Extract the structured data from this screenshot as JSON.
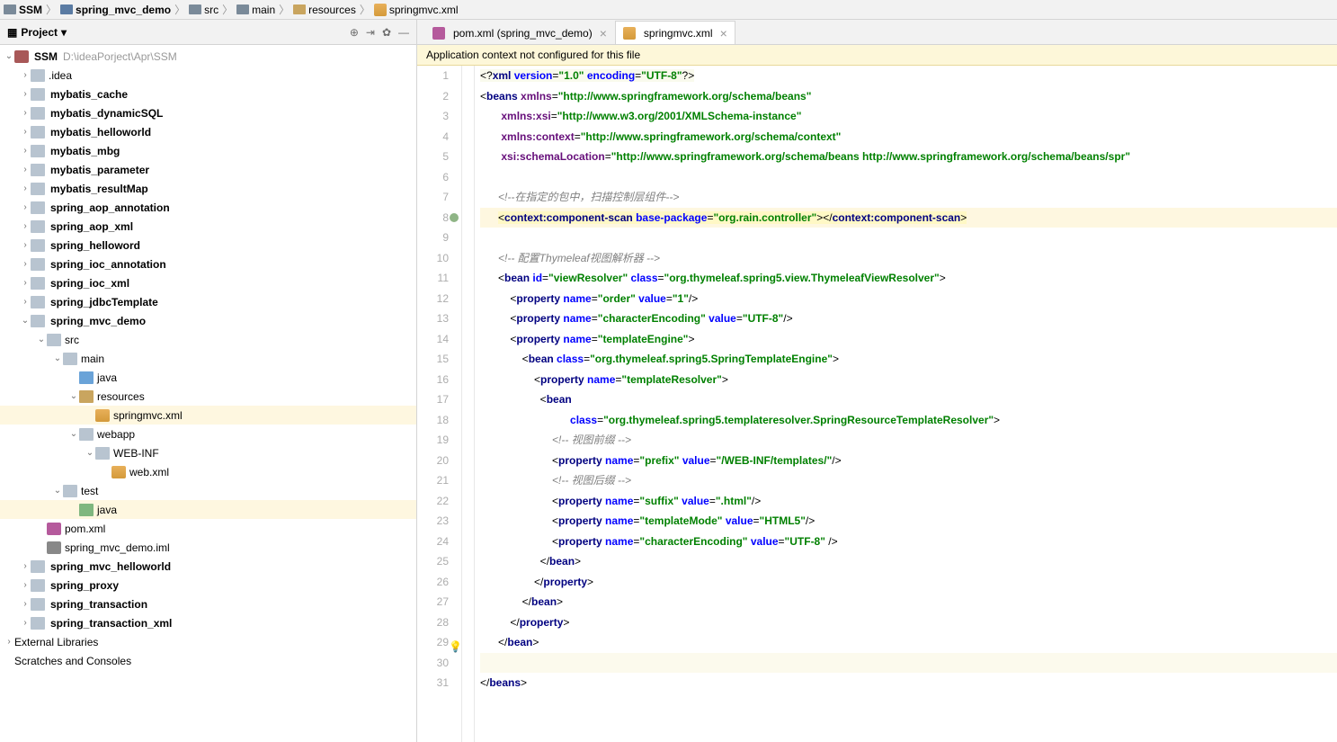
{
  "breadcrumb": {
    "items": [
      "SSM",
      "spring_mvc_demo",
      "src",
      "main",
      "resources",
      "springmvc.xml"
    ]
  },
  "sidebar": {
    "title": "Project",
    "root_name": "SSM",
    "root_path": "D:\\ideaPorject\\Apr\\SSM"
  },
  "tree": [
    {
      "d": 0,
      "a": "v",
      "ico": "proj",
      "bold": "SSM",
      "path": "D:\\ideaPorject\\Apr\\SSM"
    },
    {
      "d": 1,
      "a": ">",
      "ico": "folder",
      "txt": ".idea"
    },
    {
      "d": 1,
      "a": ">",
      "ico": "folder",
      "bold": "mybatis_cache"
    },
    {
      "d": 1,
      "a": ">",
      "ico": "folder",
      "bold": "mybatis_dynamicSQL"
    },
    {
      "d": 1,
      "a": ">",
      "ico": "folder",
      "bold": "mybatis_helloworld"
    },
    {
      "d": 1,
      "a": ">",
      "ico": "folder",
      "bold": "mybatis_mbg"
    },
    {
      "d": 1,
      "a": ">",
      "ico": "folder",
      "bold": "mybatis_parameter"
    },
    {
      "d": 1,
      "a": ">",
      "ico": "folder",
      "bold": "mybatis_resultMap"
    },
    {
      "d": 1,
      "a": ">",
      "ico": "folder",
      "bold": "spring_aop_annotation"
    },
    {
      "d": 1,
      "a": ">",
      "ico": "folder",
      "bold": "spring_aop_xml"
    },
    {
      "d": 1,
      "a": ">",
      "ico": "folder",
      "bold": "spring_helloword"
    },
    {
      "d": 1,
      "a": ">",
      "ico": "folder",
      "bold": "spring_ioc_annotation"
    },
    {
      "d": 1,
      "a": ">",
      "ico": "folder",
      "bold": "spring_ioc_xml"
    },
    {
      "d": 1,
      "a": ">",
      "ico": "folder",
      "bold": "spring_jdbcTemplate"
    },
    {
      "d": 1,
      "a": "v",
      "ico": "folder",
      "bold": "spring_mvc_demo"
    },
    {
      "d": 2,
      "a": "v",
      "ico": "folder",
      "txt": "src"
    },
    {
      "d": 3,
      "a": "v",
      "ico": "folder",
      "txt": "main"
    },
    {
      "d": 4,
      "a": "",
      "ico": "folder-src",
      "txt": "java"
    },
    {
      "d": 4,
      "a": "v",
      "ico": "folder-res",
      "txt": "resources"
    },
    {
      "d": 5,
      "a": "",
      "ico": "xml",
      "txt": "springmvc.xml",
      "sel": true
    },
    {
      "d": 4,
      "a": "v",
      "ico": "folder",
      "txt": "webapp"
    },
    {
      "d": 5,
      "a": "v",
      "ico": "folder",
      "txt": "WEB-INF"
    },
    {
      "d": 6,
      "a": "",
      "ico": "xml",
      "txt": "web.xml"
    },
    {
      "d": 3,
      "a": "v",
      "ico": "folder",
      "txt": "test"
    },
    {
      "d": 4,
      "a": "",
      "ico": "folder-test",
      "txt": "java",
      "sel": true
    },
    {
      "d": 2,
      "a": "",
      "ico": "maven",
      "txt": "pom.xml"
    },
    {
      "d": 2,
      "a": "",
      "ico": "iml",
      "txt": "spring_mvc_demo.iml"
    },
    {
      "d": 1,
      "a": ">",
      "ico": "folder",
      "bold": "spring_mvc_helloworld"
    },
    {
      "d": 1,
      "a": ">",
      "ico": "folder",
      "bold": "spring_proxy"
    },
    {
      "d": 1,
      "a": ">",
      "ico": "folder",
      "bold": "spring_transaction"
    },
    {
      "d": 1,
      "a": ">",
      "ico": "folder",
      "bold": "spring_transaction_xml"
    },
    {
      "d": 0,
      "a": ">",
      "ico": "",
      "txt": "External Libraries"
    },
    {
      "d": 0,
      "a": "",
      "ico": "",
      "txt": "Scratches and Consoles"
    }
  ],
  "tabs": [
    {
      "label": "pom.xml (spring_mvc_demo)",
      "ico": "maven"
    },
    {
      "label": "springmvc.xml",
      "ico": "xml",
      "active": true
    }
  ],
  "warning": "Application context not configured for this file",
  "code_lines": 31,
  "code": {
    "l1": "<?xml version=\"1.0\" encoding=\"UTF-8\"?>",
    "l2_tag": "beans",
    "l2_xmlns": "http://www.springframework.org/schema/beans",
    "l3_k": "xmlns:xsi",
    "l3_v": "http://www.w3.org/2001/XMLSchema-instance",
    "l4_k": "xmlns:context",
    "l4_v": "http://www.springframework.org/schema/context",
    "l5_k": "xsi:schemaLocation",
    "l5_v": "http://www.springframework.org/schema/beans http://www.springframework.org/schema/beans/spr",
    "l7_c": "<!--在指定的包中，扫描控制层组件-->",
    "l8_tag": "context:component-scan",
    "l8_attr": "base-package",
    "l8_val": "org.rain.controller",
    "l10_c": "<!-- 配置Thymeleaf视图解析器 -->",
    "l11_tag": "bean",
    "l11_id": "viewResolver",
    "l11_class": "org.thymeleaf.spring5.view.ThymeleafViewResolver",
    "l12_name": "order",
    "l12_val": "1",
    "l13_name": "characterEncoding",
    "l13_val": "UTF-8",
    "l14_name": "templateEngine",
    "l15_class": "org.thymeleaf.spring5.SpringTemplateEngine",
    "l16_name": "templateResolver",
    "l18_class": "org.thymeleaf.spring5.templateresolver.SpringResourceTemplateResolver",
    "l19_c": "<!-- 视图前缀 -->",
    "l20_name": "prefix",
    "l20_val": "/WEB-INF/templates/",
    "l21_c": "<!-- 视图后缀 -->",
    "l22_name": "suffix",
    "l22_val": ".html",
    "l23_name": "templateMode",
    "l23_val": "HTML5",
    "l24_name": "characterEncoding",
    "l24_val": "UTF-8"
  }
}
